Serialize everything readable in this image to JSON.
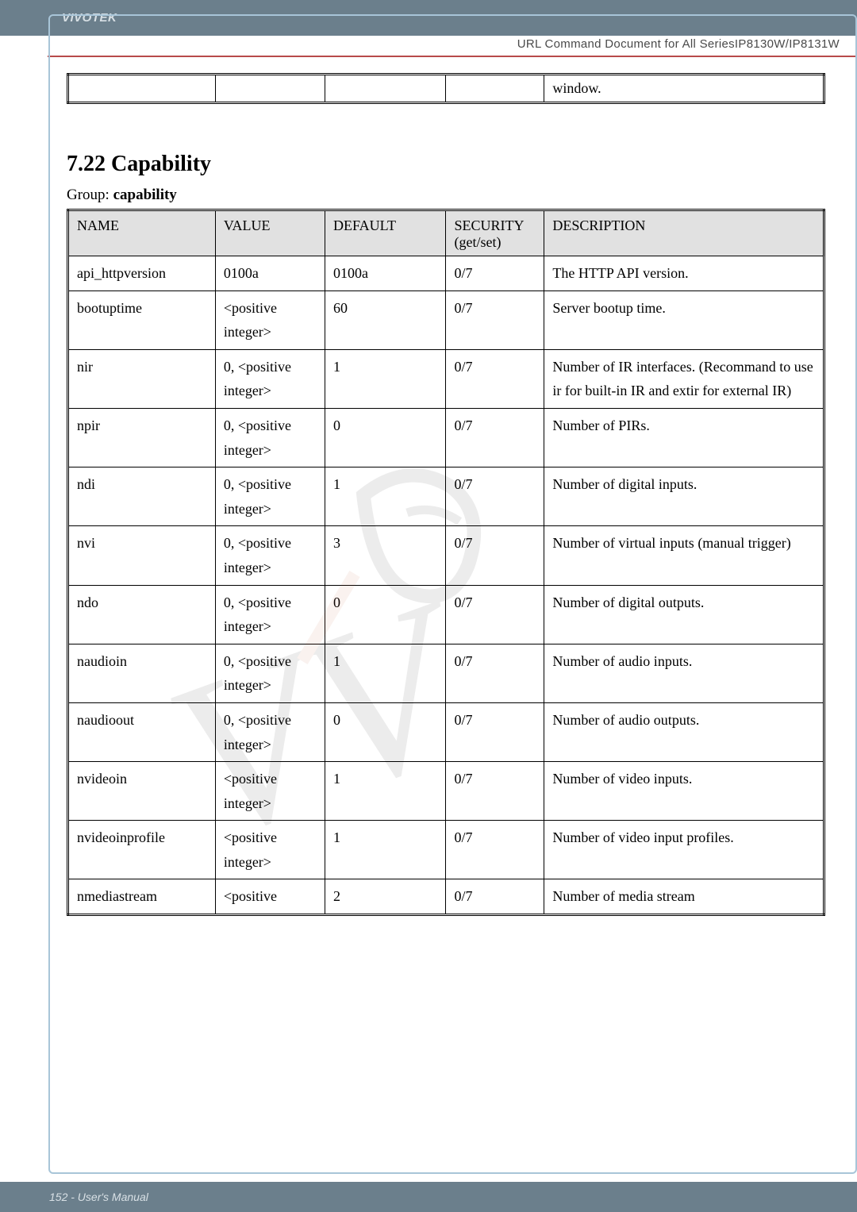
{
  "header": {
    "brand": "VIVOTEK",
    "controls_title": "URL Command Document for All SeriesIP8130W/IP8131W"
  },
  "carryover_cell": "window.",
  "section": {
    "number_title": "7.22 Capability",
    "group_prefix": "Group: ",
    "group_name": "capability"
  },
  "columns": {
    "name": "NAME",
    "value": "VALUE",
    "default": "DEFAULT",
    "security": "SECURITY (get/set)",
    "description": "DESCRIPTION"
  },
  "rows": [
    {
      "name": "api_httpversion",
      "value": "0100a",
      "default": "0100a",
      "security": "0/7",
      "description": "The HTTP API version."
    },
    {
      "name": "bootuptime",
      "value": "<positive integer>",
      "default": "60",
      "security": "0/7",
      "description": "Server bootup time."
    },
    {
      "name": "nir",
      "value": "0, <positive integer>",
      "default": "1",
      "security": "0/7",
      "description": "Number of IR interfaces. (Recommand to use ir for built-in IR and extir for external IR)"
    },
    {
      "name": "npir",
      "value": "0, <positive integer>",
      "default": "0",
      "security": "0/7",
      "description": "Number of PIRs."
    },
    {
      "name": "ndi",
      "value": "0, <positive integer>",
      "default": "1",
      "security": "0/7",
      "description": "Number of digital inputs."
    },
    {
      "name": "nvi",
      "value": "0, <positive integer>",
      "default": "3",
      "security": "0/7",
      "description": "Number of virtual inputs (manual trigger)"
    },
    {
      "name": "ndo",
      "value": "0, <positive integer>",
      "default": "0",
      "security": "0/7",
      "description": "Number of digital outputs."
    },
    {
      "name": "naudioin",
      "value": "0, <positive integer>",
      "default": "1",
      "security": "0/7",
      "description": "Number of audio inputs."
    },
    {
      "name": "naudioout",
      "value": "0, <positive integer>",
      "default": "0",
      "security": "0/7",
      "description": "Number of audio outputs."
    },
    {
      "name": "nvideoin",
      "value": "<positive integer>",
      "default": "1",
      "security": "0/7",
      "description": "Number of video inputs."
    },
    {
      "name": "nvideoinprofile",
      "value": "<positive integer>",
      "default": "1",
      "security": "0/7",
      "description": "Number of video input profiles."
    },
    {
      "name": "nmediastream",
      "value": "<positive",
      "default": "2",
      "security": "0/7",
      "description": "Number of media stream"
    }
  ],
  "footer": {
    "page_label": "152 - User's Manual"
  }
}
